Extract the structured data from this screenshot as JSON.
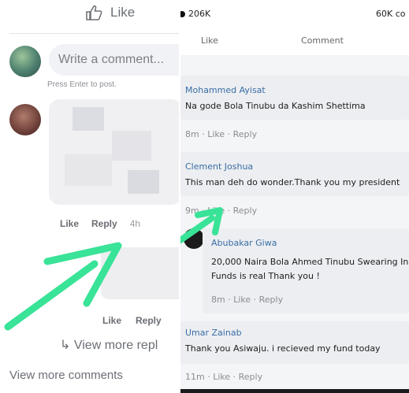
{
  "left": {
    "like_label": "Like",
    "comment_placeholder": "Write a comment...",
    "press_enter": "Press Enter to post.",
    "actions": {
      "like": "Like",
      "reply": "Reply",
      "time": "4h"
    },
    "actions2": {
      "like": "Like",
      "reply": "Reply"
    },
    "view_more_replies": "View more repl",
    "view_more_comments": "View more comments"
  },
  "right": {
    "stats": {
      "likes": "206K",
      "comments": "60K co"
    },
    "actions": {
      "like": "Like",
      "comment": "Comment"
    },
    "comments": [
      {
        "name": "Mohammed Ayisat",
        "text": "Na gode Bola Tinubu da Kashim Shettima",
        "meta": "8m · Like · Reply"
      },
      {
        "name": "Clement Joshua",
        "text": "This man deh do wonder.Thank you my president",
        "meta": "9m · Like · Reply"
      },
      {
        "name": "Abubakar Giwa",
        "text_line1": "20,000 Naira Bola Ahmed Tinubu Swearing In",
        "text_line2": "Funds is real Thank you !",
        "meta": "8m · Like · Reply"
      },
      {
        "name": "Umar Zainab",
        "text": "Thank you Asiwaju. i recieved my fund today",
        "meta": "11m · Like · Reply"
      }
    ]
  },
  "colors": {
    "arrow": "#39e397",
    "name_link": "#3a6ea5"
  }
}
